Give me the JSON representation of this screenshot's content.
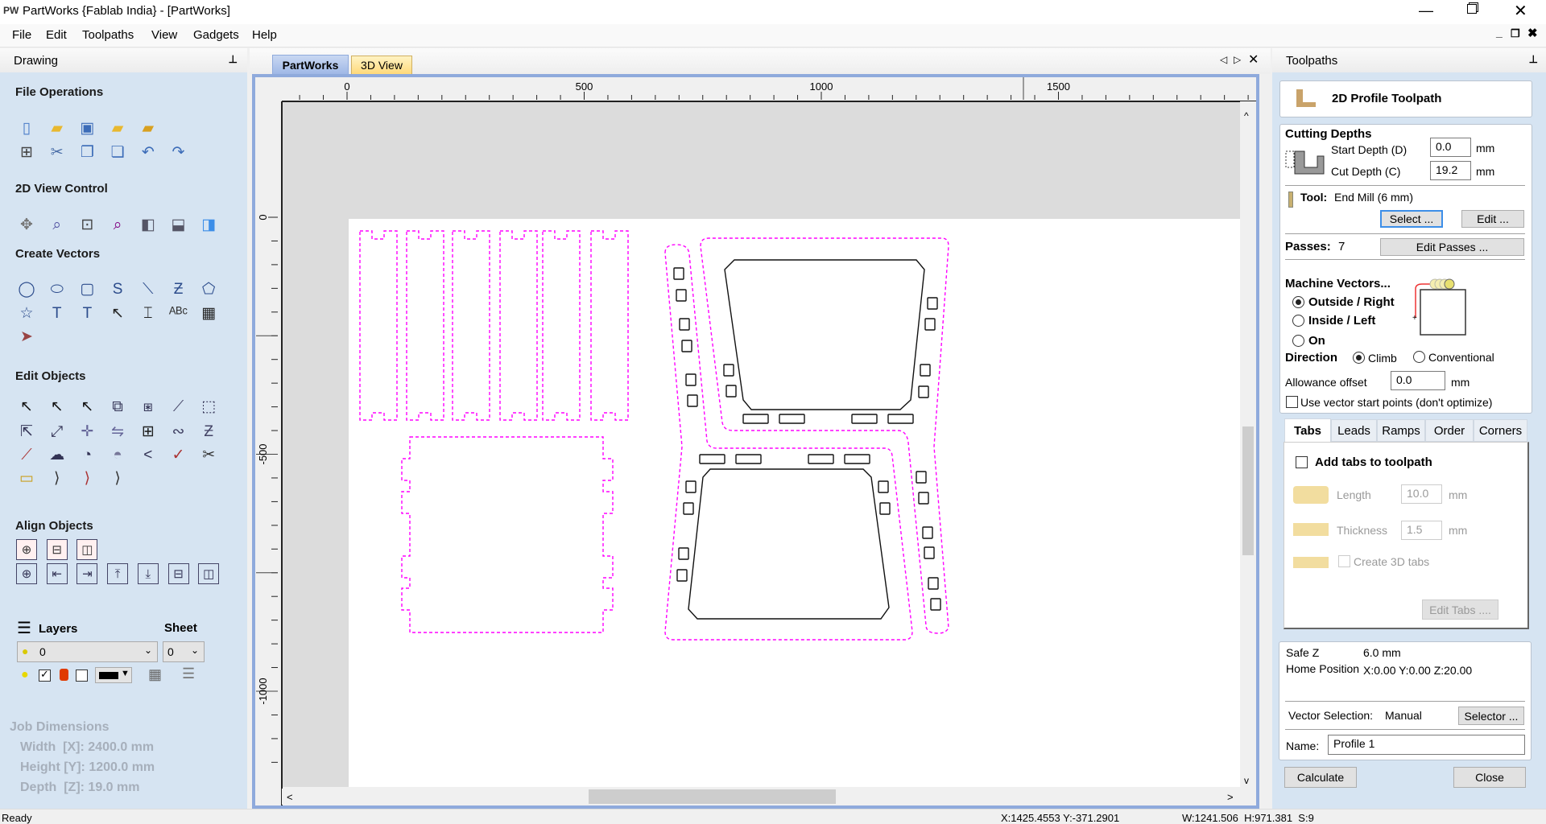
{
  "window": {
    "logo": "PW",
    "title": "PartWorks {Fablab India} - [PartWorks]"
  },
  "menu": [
    "File",
    "Edit",
    "Toolpaths",
    "View",
    "Gadgets",
    "Help"
  ],
  "left_panel": {
    "title": "Drawing",
    "sections": {
      "file_operations": "File Operations",
      "view_control": "2D View Control",
      "create_vectors": "Create Vectors",
      "edit_objects": "Edit Objects",
      "align_objects": "Align Objects"
    },
    "icons": {
      "file_operations": [
        [
          "new-file-icon",
          "open-file-icon",
          "save-file-icon",
          "open-component-icon",
          "import-bitmap-icon"
        ],
        [
          "job-setup-icon",
          "cut-icon",
          "copy-icon",
          "paste-icon",
          "undo-icon",
          "redo-icon"
        ]
      ],
      "view_control": [
        [
          "pan-icon",
          "zoom-box-icon",
          "zoom-all-icon",
          "zoom-selection-icon",
          "toggle-left-pane-icon",
          "toggle-bottom-pane-icon",
          "toggle-right-pane-icon"
        ]
      ],
      "create_vectors": [
        [
          "circle-icon",
          "ellipse-icon",
          "rectangle-icon",
          "polyline-icon",
          "curve-icon",
          "zigzag-icon",
          "polygon-icon"
        ],
        [
          "star-icon",
          "text-icon",
          "auto-layout-text-icon",
          "text-on-curve-icon",
          "bend-text-icon",
          "arc-text-icon",
          "fonts-grid-icon"
        ],
        [
          "bitmap-trace-icon"
        ]
      ],
      "edit_objects": [
        [
          "select-icon",
          "node-edit-icon",
          "transform-icon",
          "group-icon",
          "ungroup-icon",
          "measure-icon",
          "distort-icon"
        ],
        [
          "move-icon",
          "scale-icon",
          "rotate-icon",
          "mirror-icon",
          "array-copy-icon",
          "join-vectors-icon",
          "smart-snap-icon"
        ],
        [
          "trim-icon",
          "weld-icon",
          "subtract-icon",
          "intersect-icon",
          "fillet-icon",
          "curve-fit-icon",
          "scissors-icon"
        ],
        [
          "offset-icon",
          "dogbone-icon",
          "tbone-icon",
          "ctrl-point-icon"
        ]
      ],
      "align_objects": [
        [
          "center-in-material-icon",
          "center-horizontal-icon",
          "center-vertical-icon"
        ],
        [
          "align-center-icon",
          "align-left-icon",
          "align-right-icon",
          "align-top-icon",
          "align-bottom-icon",
          "align-h-center-icon",
          "align-v-center-icon"
        ]
      ]
    },
    "layers": {
      "label": "Layers",
      "sheet_label": "Sheet",
      "layer_value": "0",
      "sheet_value": "0",
      "layer_color": "#000000"
    },
    "job_dimensions": {
      "title": "Job Dimensions",
      "width": "Width  [X]: 2400.0 mm",
      "height": "Height [Y]: 1200.0 mm",
      "depth": "Depth  [Z]: 19.0 mm"
    }
  },
  "center": {
    "tabs": [
      "PartWorks",
      "3D View"
    ],
    "ruler_x": [
      "0",
      "500",
      "1000",
      "1500"
    ],
    "ruler_y": [
      "0",
      "-500",
      "-1000"
    ]
  },
  "right_panel": {
    "title": "Toolpaths",
    "heading": "2D Profile Toolpath",
    "cutting_depths": {
      "title": "Cutting Depths",
      "start_label": "Start Depth (D)",
      "start_value": "0.0",
      "cut_label": "Cut Depth (C)",
      "cut_value": "19.2",
      "unit": "mm"
    },
    "tool": {
      "label": "Tool:",
      "value": "End Mill (6 mm)",
      "select": "Select ...",
      "edit": "Edit ..."
    },
    "passes": {
      "label": "Passes:",
      "value": "7",
      "button": "Edit Passes ..."
    },
    "machine_vectors": {
      "title": "Machine Vectors...",
      "options": [
        "Outside / Right",
        "Inside / Left",
        "On"
      ],
      "selected": 0
    },
    "direction": {
      "label": "Direction",
      "options": [
        "Climb",
        "Conventional"
      ],
      "selected": 0
    },
    "allowance": {
      "label": "Allowance offset",
      "value": "0.0",
      "unit": "mm"
    },
    "use_start_points": {
      "label": "Use vector start points (don't optimize)",
      "checked": false
    },
    "tabs": [
      "Tabs",
      "Leads",
      "Ramps",
      "Order",
      "Corners"
    ],
    "tabs_panel": {
      "add_tabs": "Add tabs to toolpath",
      "length_label": "Length",
      "length_value": "10.0",
      "thickness_label": "Thickness",
      "thickness_value": "1.5",
      "unit": "mm",
      "create_3d": "Create 3D tabs",
      "edit_tabs": "Edit Tabs ...."
    },
    "info": {
      "safe_z_label": "Safe Z",
      "safe_z_value": "6.0 mm",
      "home_label": "Home Position",
      "home_value": "X:0.00 Y:0.00 Z:20.00"
    },
    "vector_selection": {
      "label": "Vector Selection:",
      "value": "Manual",
      "button": "Selector ..."
    },
    "name": {
      "label": "Name:",
      "value": "Profile 1"
    },
    "calculate": "Calculate",
    "close": "Close"
  },
  "status": {
    "left": "Ready",
    "coords": "X:1425.4553 Y:-371.2901",
    "size": "W:1241.506  H:971.381  S:9"
  },
  "colors": {
    "panel": "#d6e4f2",
    "toolpath": "#ff00ff",
    "frame": "#8faadc"
  }
}
